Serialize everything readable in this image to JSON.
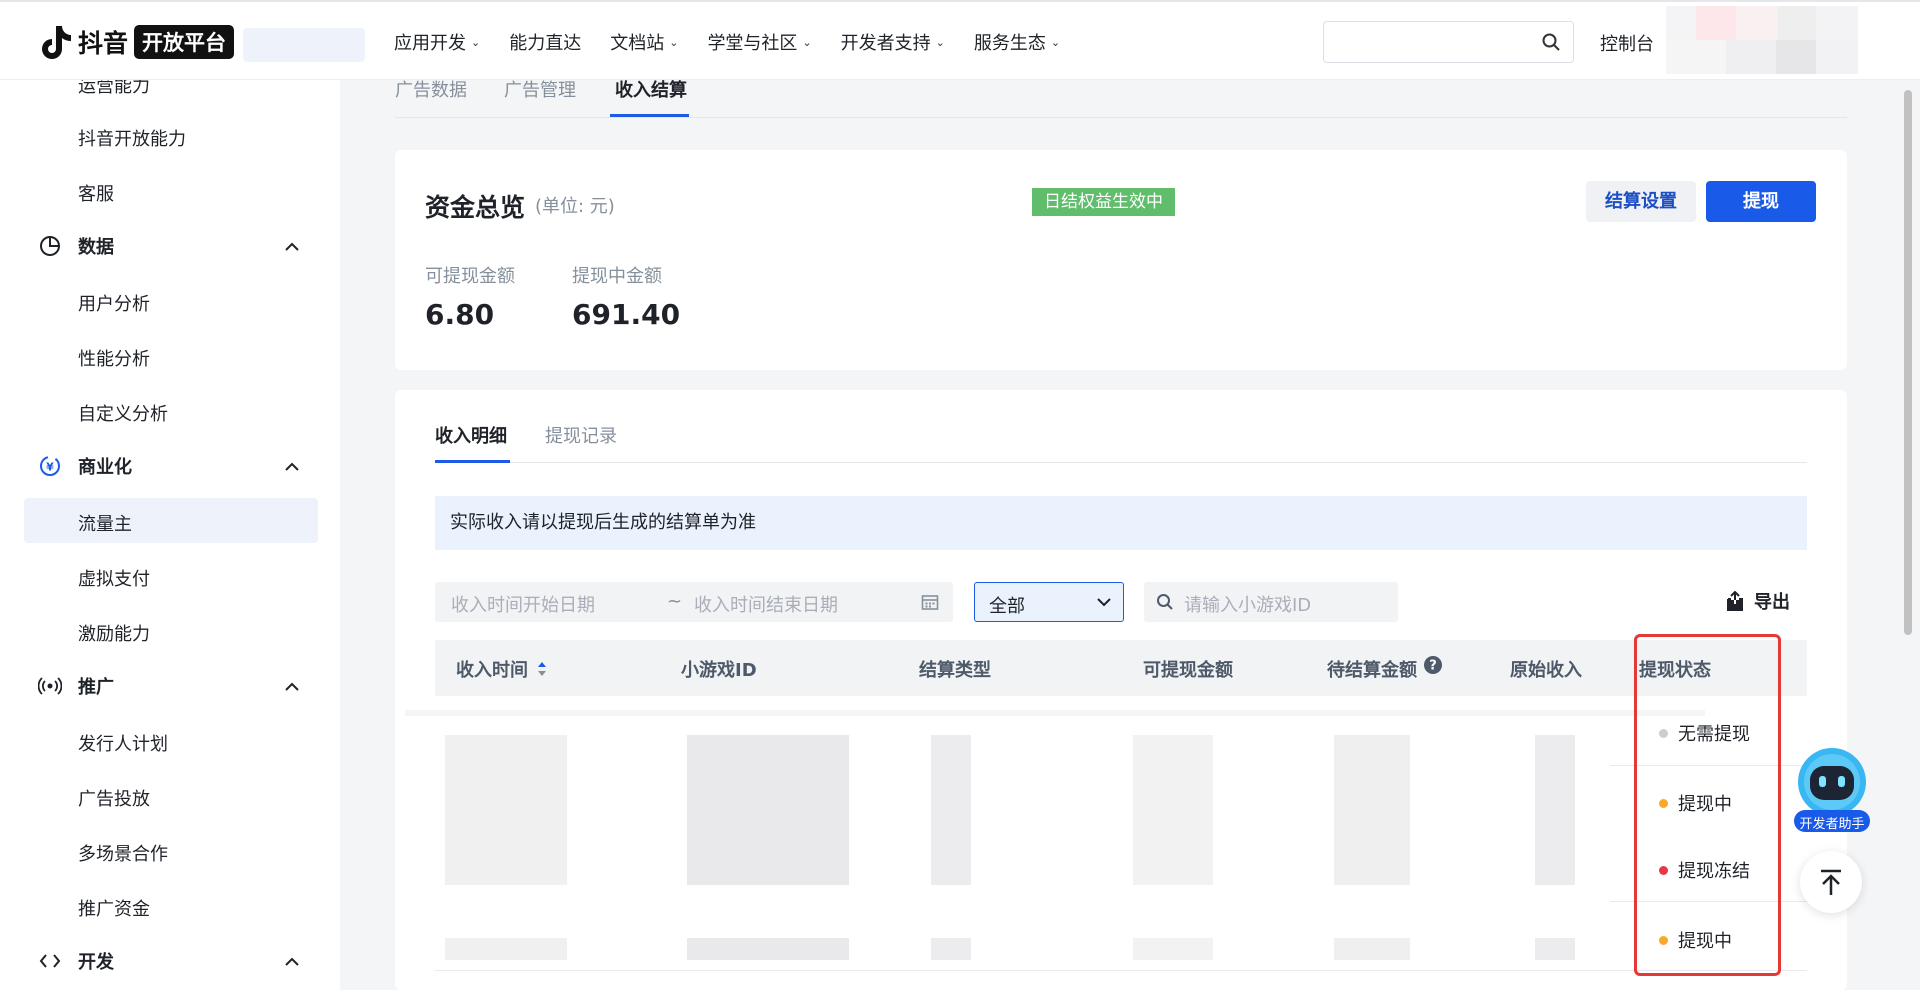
{
  "brand": {
    "name": "抖音",
    "badge": "开放平台"
  },
  "nav": {
    "items": [
      {
        "label": "应用开发",
        "caret": true
      },
      {
        "label": "能力直达",
        "caret": false
      },
      {
        "label": "文档站",
        "caret": true
      },
      {
        "label": "学堂与社区",
        "caret": true
      },
      {
        "label": "开发者支持",
        "caret": true
      },
      {
        "label": "服务生态",
        "caret": true
      }
    ],
    "console": "控制台"
  },
  "sidebar": {
    "items_top": [
      "运营能力",
      "抖音开放能力",
      "客服"
    ],
    "groups": [
      {
        "label": "数据",
        "icon": "pie-chart-icon",
        "items": [
          "用户分析",
          "性能分析",
          "自定义分析"
        ]
      },
      {
        "label": "商业化",
        "icon": "yuan-coin-icon",
        "items": [
          "流量主",
          "虚拟支付",
          "激励能力"
        ]
      },
      {
        "label": "推广",
        "icon": "broadcast-icon",
        "items": [
          "发行人计划",
          "广告投放",
          "多场景合作",
          "推广资金"
        ]
      },
      {
        "label": "开发",
        "icon": "code-icon",
        "items": []
      }
    ],
    "active": "流量主"
  },
  "top_tabs": [
    "广告数据",
    "广告管理",
    "收入结算"
  ],
  "fund": {
    "title": "资金总览",
    "unit": "(单位: 元)",
    "badge": "日结权益生效中",
    "settings_btn": "结算设置",
    "withdraw_btn": "提现",
    "available_label": "可提现金额",
    "available_value": "6.80",
    "pending_label": "提现中金额",
    "pending_value": "691.40"
  },
  "detail": {
    "tabs": [
      "收入明细",
      "提现记录"
    ],
    "notice": "实际收入请以提现后生成的结算单为准",
    "date_start_placeholder": "收入时间开始日期",
    "date_sep": "~",
    "date_end_placeholder": "收入时间结束日期",
    "select_value": "全部",
    "game_id_placeholder": "请输入小游戏ID",
    "export": "导出",
    "columns": [
      "收入时间",
      "小游戏ID",
      "结算类型",
      "可提现金额",
      "待结算金额",
      "原始收入",
      "提现状态"
    ],
    "rows": [
      {
        "status": "无需提现",
        "dot": "#c9cdd4"
      },
      {
        "status": "提现中",
        "dot": "#f7a928"
      },
      {
        "status": "提现冻结",
        "dot": "#e8364a"
      },
      {
        "status": "提现中",
        "dot": "#f7a928"
      }
    ]
  },
  "assistant": {
    "label": "开发者助手"
  },
  "colors": {
    "primary": "#1a5ae8",
    "badge_green": "#5fbd6b",
    "highlight_red": "#e53935"
  }
}
